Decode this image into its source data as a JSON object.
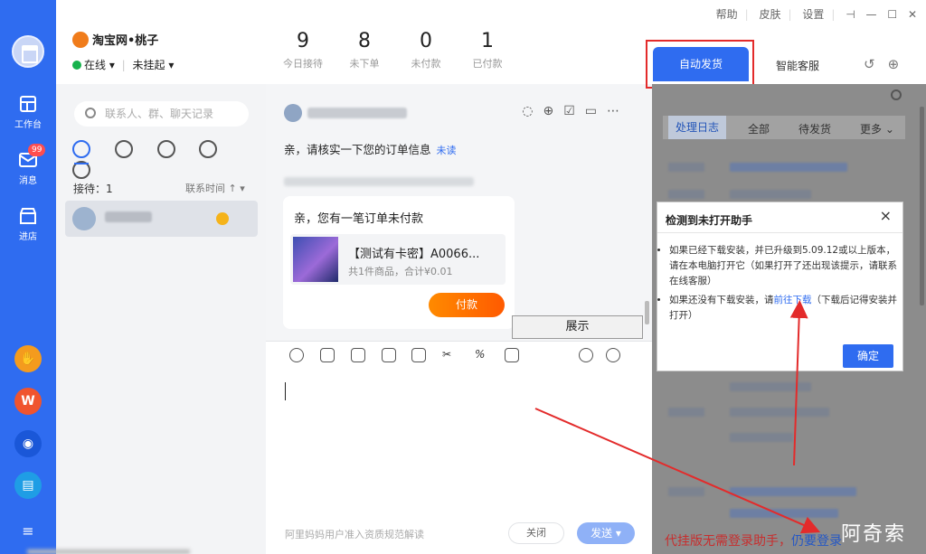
{
  "shop": {
    "name": "淘宝网•桃子",
    "status": "在线 ▾",
    "hang": "未挂起 ▾"
  },
  "stats": [
    {
      "value": "9",
      "label": "今日接待"
    },
    {
      "value": "8",
      "label": "未下单"
    },
    {
      "value": "0",
      "label": "未付款"
    },
    {
      "value": "1",
      "label": "已付款"
    }
  ],
  "window": {
    "help": "帮助",
    "skin": "皮肤",
    "settings": "设置"
  },
  "rail": {
    "workbench": "工作台",
    "messages": "消息",
    "badge": "99",
    "shop_entry": "进店",
    "menu": "≡"
  },
  "contacts": {
    "search_placeholder": "联系人、群、聊天记录",
    "receiving": "接待：1",
    "sort": "联系时间 ↑ ▾"
  },
  "chat": {
    "message": "亲，请核实一下您的订单信息",
    "unread": "未读",
    "card_title": "亲，您有一笔订单未付款",
    "product_name": "【测试有卡密】A0066...",
    "product_desc": "共1件商品，合计¥0.01",
    "pay_label": "付款",
    "show_label": "展示",
    "compose_hint": "阿里妈妈用户准入资质规范解读",
    "close_label": "关闭",
    "send_label": "发送 ▾"
  },
  "panel": {
    "tab_auto": "自动发货",
    "tab_smart": "智能客服",
    "subtabs": [
      "处理日志",
      "全部",
      "待发货",
      "更多 ⌄"
    ]
  },
  "dialog": {
    "title": "检测到未打开助手",
    "item1": "如果已经下载安装，并已升级到5.09.12或以上版本，请在本电脑打开它（如果打开了还出现该提示，请联系在线客服）",
    "item2_prefix": "如果还没有下载安装，请",
    "item2_link": "前往下载",
    "item2_suffix": "（下载后记得安装并打开）",
    "ok": "确定"
  },
  "footer": {
    "text_red": "代挂版无需登录助手，",
    "text_blue": "仍要登录",
    "watermark": "阿奇索"
  },
  "colors": {
    "brand_blue": "#2f6cf0",
    "highlight_red": "#e32b2b",
    "pay_orange": "#ff6a00"
  }
}
